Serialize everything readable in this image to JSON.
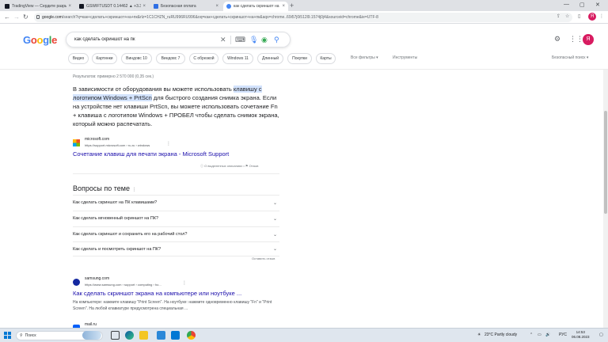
{
  "browser": {
    "tabs": [
      {
        "label": "TradingView — Сердите разрыв...",
        "icon": "tradingview-icon",
        "color": "#131722",
        "active": false
      },
      {
        "label": "GSWIFTUSDT 0.14462 ▲ +3.33% ...",
        "icon": "tradingview-icon",
        "color": "#131722",
        "active": false
      },
      {
        "label": "Безопасная оплата",
        "icon": "payment-icon",
        "color": "#2f6fe4",
        "active": false
      },
      {
        "label": "как сделать скриншот на пк — ...",
        "icon": "google-icon",
        "color": "#4285f4",
        "active": true
      }
    ],
    "new_tab": "+",
    "url_domain": "google.com",
    "url_rest": "/search?q=как+сделать+скриншот+на+пк&rlz=1C1CHZN_ruRU996RU996&oq=как+сделать+скриншот+на+пк&aqs=chrome..69i57j0i512l9.1574j0j4&sourceid=chrome&ie=UTF-8",
    "profile_initial": "Я"
  },
  "header": {
    "logo": [
      "G",
      "o",
      "o",
      "g",
      "l",
      "e"
    ],
    "logo_colors": [
      "#4285f4",
      "#ea4335",
      "#fbbc05",
      "#4285f4",
      "#34a853",
      "#ea4335"
    ],
    "query": "как сделать скриншот на пк",
    "avatar_initial": "Я"
  },
  "chips": [
    "Видео",
    "Картинки",
    "Виндовс 10",
    "Виндовс 7",
    "С обрезкой",
    "Windows 11",
    "Длинный",
    "Покупки",
    "Карты"
  ],
  "filters": {
    "all_filters": "Все фильтры",
    "tools": "Инструменты",
    "safe_search": "Безопасный поиск"
  },
  "results": {
    "stats": "Результатов: примерно 2 570 000 (0,35 сек.)",
    "snippet_parts": [
      "В зависимости от оборудования вы можете использовать ",
      "клавишу с логотипом Windows + PrtScn",
      " для быстрого создания снимка экрана. Если на устройстве нет клавиши PrtScn, вы можете использовать сочетание Fn + клавиша с логотипом Windows + ПРОБЕЛ чтобы сделать снимок экрана, который можно распечатать."
    ],
    "featured": {
      "site": "microsoft.com",
      "url": "https://support.microsoft.com › ru-ru › windows",
      "title": "Сочетание клавиш для печати экрана - Microsoft Support"
    },
    "feedback": {
      "about": "О выделенных описаниях",
      "review": "Отзыв"
    },
    "paa": {
      "title": "Вопросы по теме",
      "questions": [
        "Как сделать скриншот на ПК клавишами?",
        "Как сделать мгновенный скриншот на ПК?",
        "Как сделать скриншот и сохранить его на рабочий стол?",
        "Как сделать и посмотреть скриншот на ПК?"
      ],
      "feedback": "Оставить отзыв"
    },
    "second": {
      "site": "samsung.com",
      "url": "https://www.samsung.com › support › computing › ho...",
      "title": "Как сделать скриншот экрана на компьютере или ноутбуке ...",
      "desc": "На компьютере: нажмите клавишу \"Print Screen\". На ноутбуке: нажмите одновременно клавишу \"Fn\" и \"Print Screen\". На любой клавиатуре предусмотрена специальная ..."
    },
    "third": {
      "site": "mail.ru"
    }
  },
  "taskbar": {
    "search": "Поиск",
    "weather": "23°C  Partly cloudy",
    "lang": "РУС",
    "time": "14:53",
    "date": "06.08.2023"
  }
}
